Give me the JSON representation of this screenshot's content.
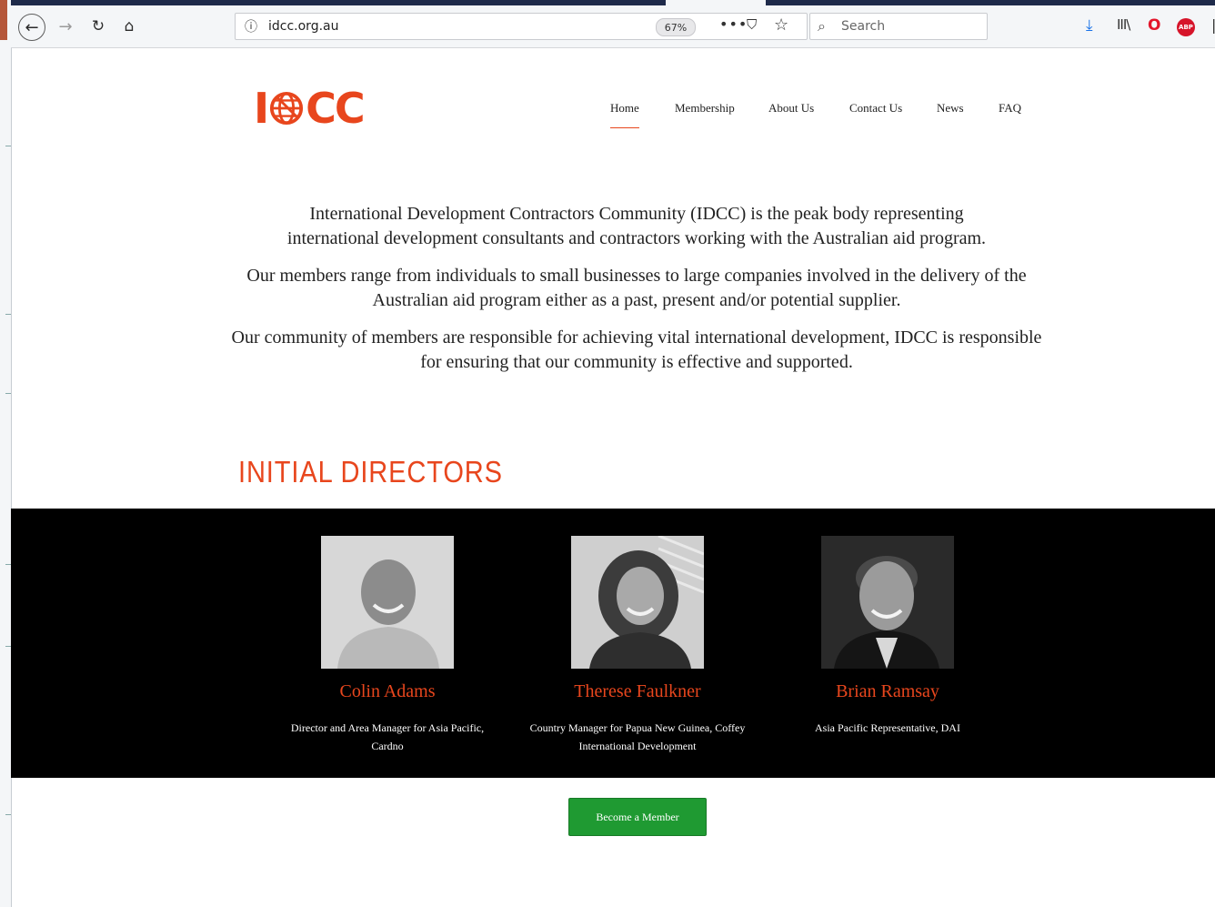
{
  "browser": {
    "url": "idcc.org.au",
    "zoom": "67%",
    "search_placeholder": "Search",
    "more_label": "•••",
    "abp_label": "ABP"
  },
  "site": {
    "logo_text_left": "I",
    "logo_text_right": "CC",
    "accent_color": "#e8461d",
    "nav": [
      {
        "label": "Home",
        "active": true
      },
      {
        "label": "Membership"
      },
      {
        "label": "About Us"
      },
      {
        "label": "Contact Us"
      },
      {
        "label": "News"
      },
      {
        "label": "FAQ"
      }
    ]
  },
  "intro": {
    "p1": "International Development Contractors Community (IDCC) is the peak body representing international development consultants and contractors working with the Australian aid program.",
    "p2": "Our members range from individuals to small businesses to large companies involved in the delivery of the Australian aid program either as a past, present and/or potential supplier.",
    "p3": "Our community of members are responsible for achieving vital international development, IDCC is responsible for ensuring that our community is effective and supported."
  },
  "directors": {
    "heading": "INITIAL DIRECTORS",
    "people": [
      {
        "name": "Colin Adams",
        "role": "Director and Area Manager for Asia Pacific, Cardno"
      },
      {
        "name": "Therese Faulkner",
        "role": "Country Manager for Papua New Guinea, Coffey International Development"
      },
      {
        "name": "Brian Ramsay",
        "role": "Asia Pacific Representative, DAI"
      }
    ]
  },
  "cta": {
    "label": "Become a Member",
    "color": "#1f9a32"
  }
}
